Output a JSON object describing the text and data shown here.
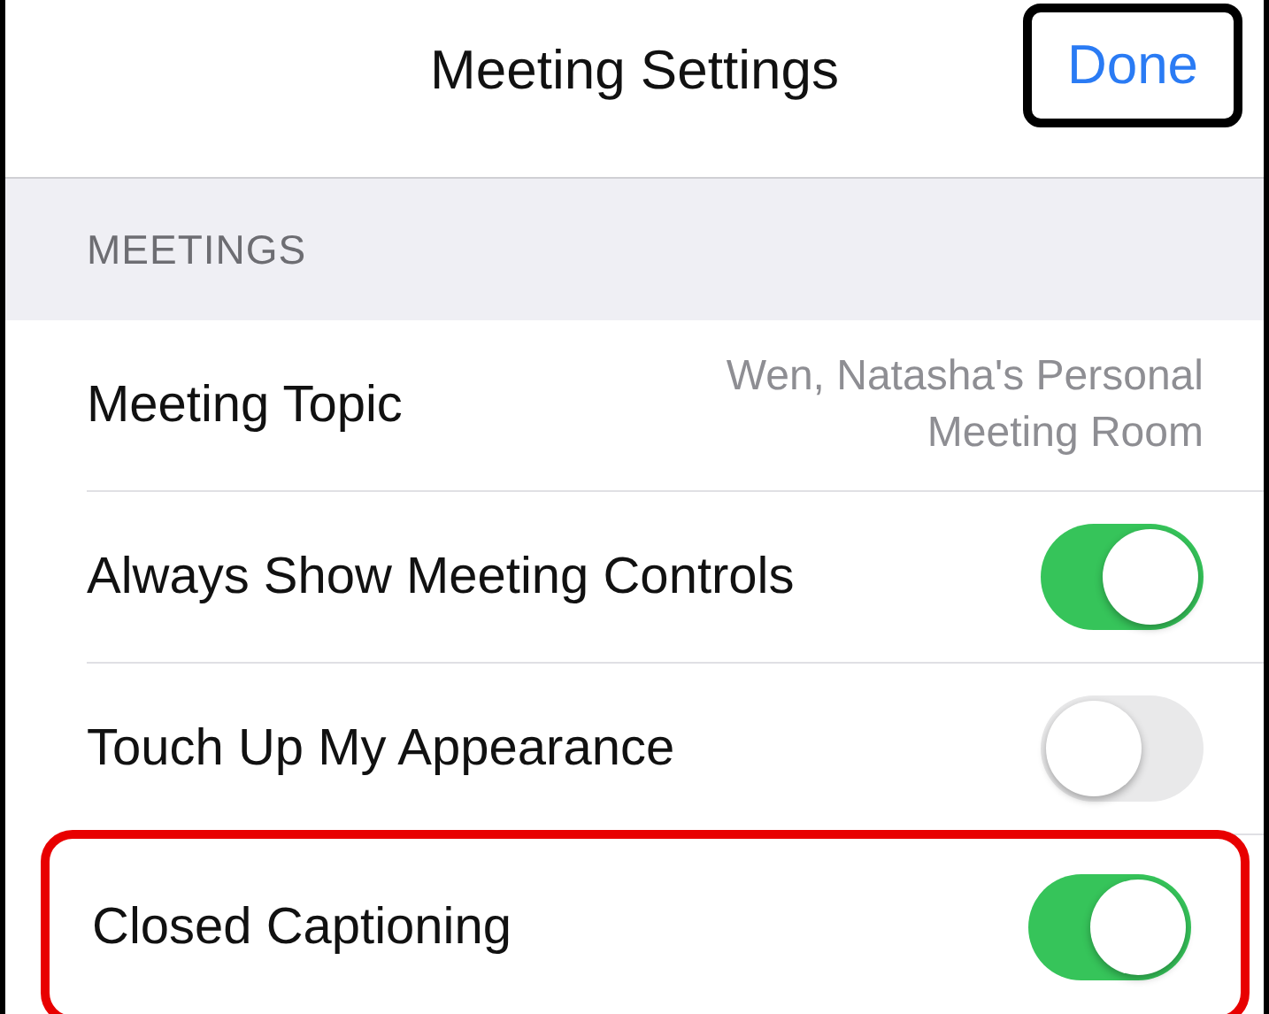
{
  "nav_bar": {
    "title": "Meeting Settings",
    "done_button": {
      "label": "Done",
      "outlined": true
    }
  },
  "section": {
    "header": "MEETINGS",
    "rows": [
      {
        "kind": "detail",
        "label": "Meeting Topic",
        "value": "Wen, Natasha's Personal Meeting Room",
        "highlighted": false
      },
      {
        "kind": "toggle",
        "label": "Always Show Meeting Controls",
        "on": true,
        "highlighted": false
      },
      {
        "kind": "toggle",
        "label": "Touch Up My Appearance",
        "on": false,
        "highlighted": false
      },
      {
        "kind": "toggle",
        "label": "Closed Captioning",
        "on": true,
        "highlighted": true
      }
    ]
  }
}
